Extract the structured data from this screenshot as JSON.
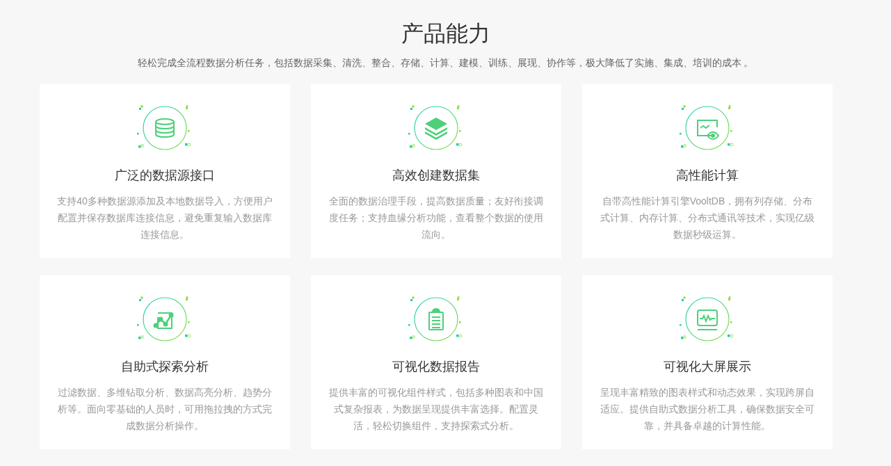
{
  "header": {
    "title": "产品能力",
    "subtitle": "轻松完成全流程数据分析任务，包括数据采集、清洗、整合、存储、计算、建模、训练、展现、协作等，极大降低了实施、集成、培训的成本 。"
  },
  "features": [
    {
      "title": "广泛的数据源接口",
      "description": "支持40多种数据源添加及本地数据导入，方便用户配置并保存数据库连接信息，避免重复输入数据库连接信息。"
    },
    {
      "title": "高效创建数据集",
      "description": "全面的数据治理手段，提高数据质量；友好衔接调度任务；支持血缘分析功能，查看整个数据的使用流向。"
    },
    {
      "title": "高性能计算",
      "description": "自带高性能计算引擎VooltDB，拥有列存储、分布式计算、内存计算、分布式通讯等技术，实现亿级数据秒级运算。"
    },
    {
      "title": "自助式探索分析",
      "description": "过滤数据、多维钻取分析、数据高亮分析、趋势分析等。面向零基础的人员时，可用拖拉拽的方式完成数据分析操作。"
    },
    {
      "title": "可视化数据报告",
      "description": "提供丰富的可视化组件样式，包括多种图表和中国式复杂报表，为数据呈现提供丰富选择。配置灵活，轻松切换组件，支持探索式分析。"
    },
    {
      "title": "可视化大屏展示",
      "description": "呈现丰富精致的图表样式和动态效果，实现跨屏自适应。提供自助式数据分析工具，确保数据安全可靠，并具备卓越的计算性能。"
    }
  ]
}
